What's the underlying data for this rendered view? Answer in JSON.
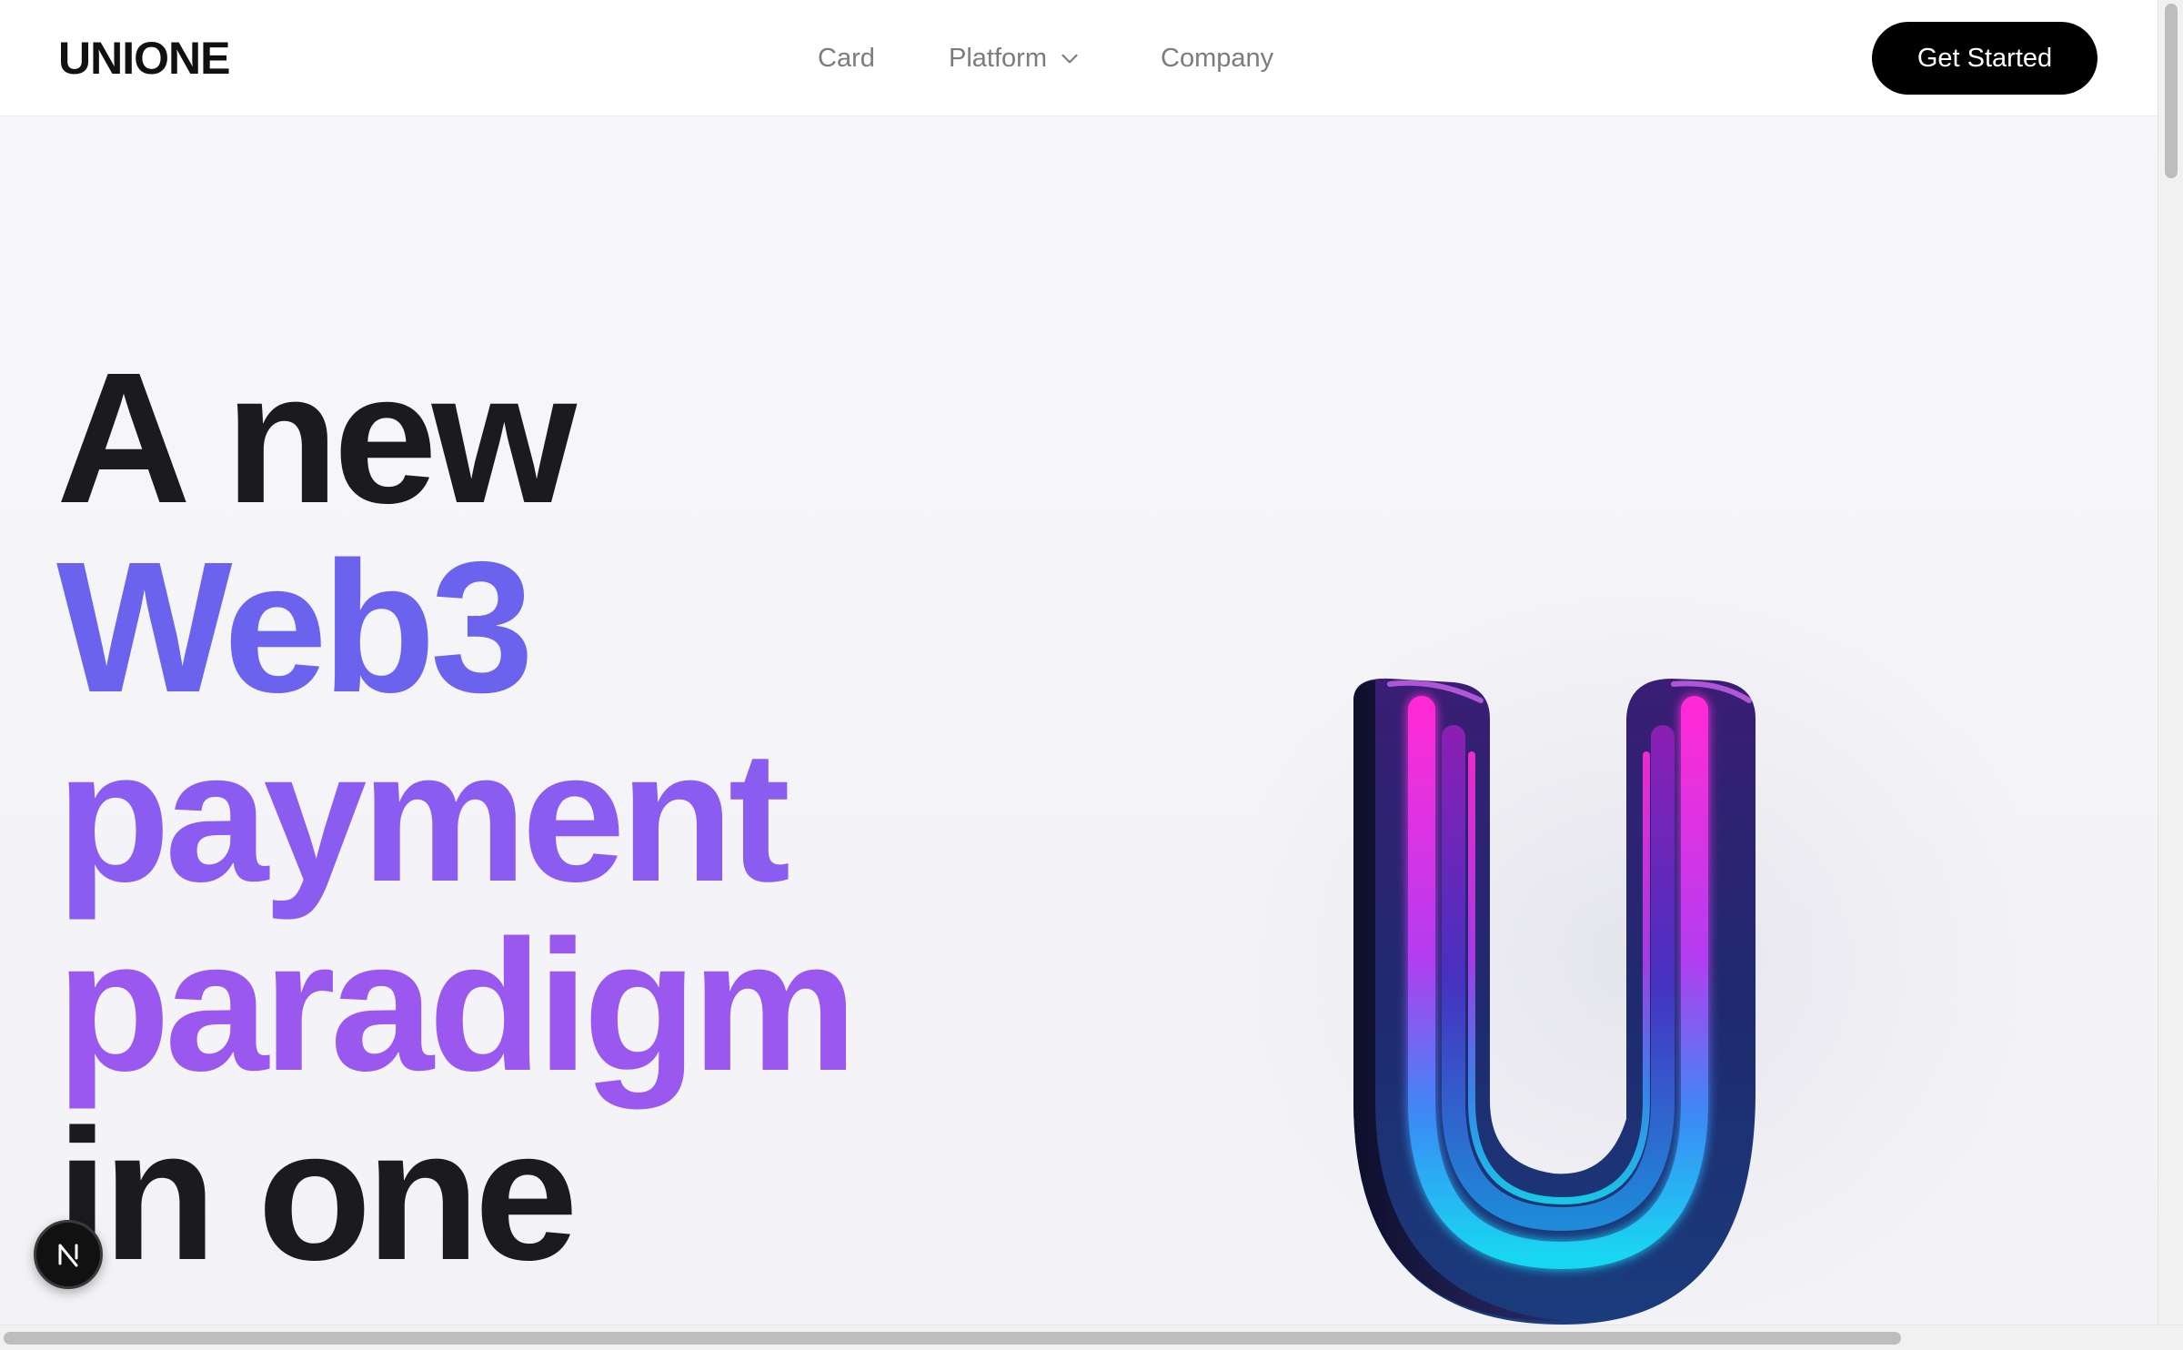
{
  "header": {
    "logo": "UNIONE",
    "nav": [
      {
        "label": "Card"
      },
      {
        "label": "Platform",
        "icon": "chevron-down-icon"
      },
      {
        "label": "Company"
      }
    ],
    "cta_label": "Get Started"
  },
  "hero": {
    "lines": [
      "A new",
      "Web3",
      "payment",
      "paradigm",
      "in one"
    ],
    "colors": {
      "dark": "#1a1a1f",
      "web3": "#6b63ee",
      "payment": "#8b5cf0",
      "paradigm": "#9b58ee"
    },
    "graphic_icon": "u-logo-3d-icon"
  },
  "badge": {
    "glyph": "N",
    "icon": "nextjs-icon"
  },
  "colors": {
    "cta_bg": "#000000",
    "cta_text": "#ffffff",
    "nav_text": "#7b7b80"
  }
}
